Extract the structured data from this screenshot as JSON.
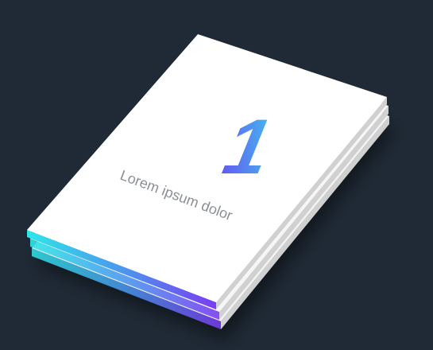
{
  "card": {
    "number": "1",
    "caption": "Lorem ipsum dolor"
  },
  "colors": {
    "background": "#1f2a36",
    "page": "#ffffff",
    "page_side": "#c8c8c8",
    "gradient_start": "#2ee6e8",
    "gradient_end": "#7a3cf2",
    "caption": "#8a8f96"
  }
}
